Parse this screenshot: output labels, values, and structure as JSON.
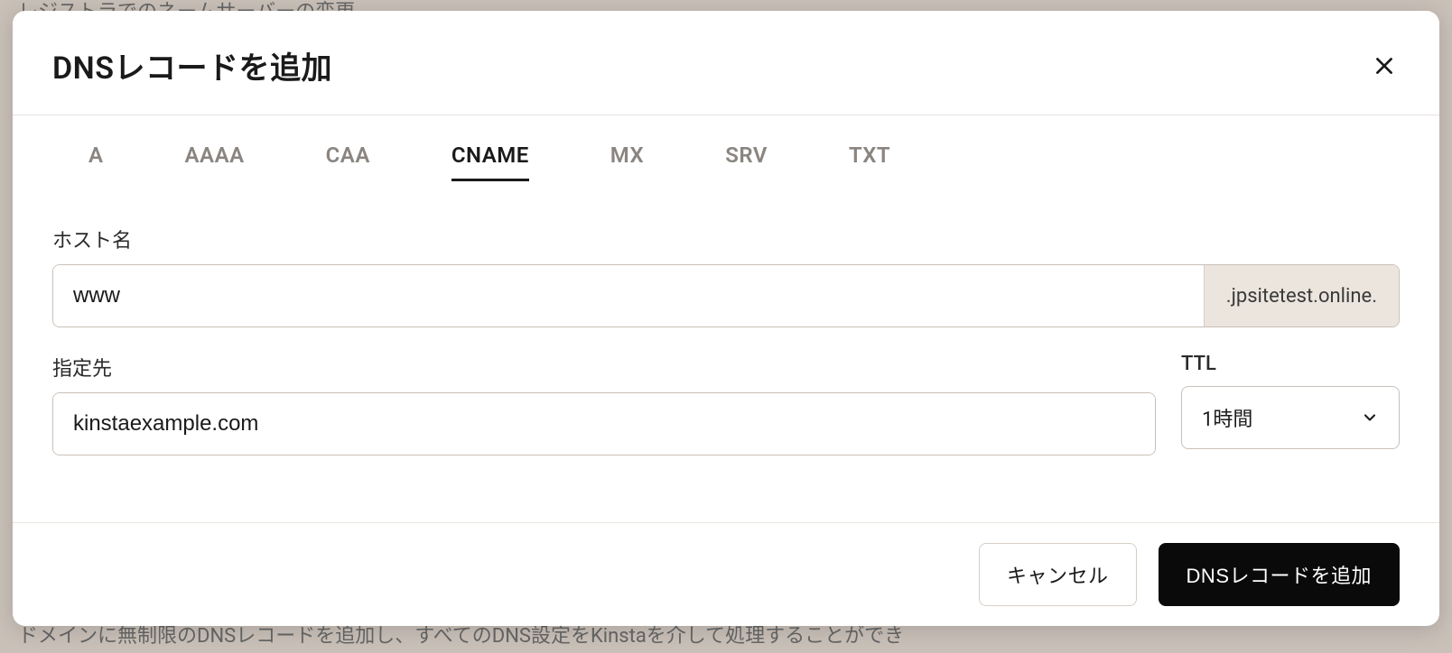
{
  "backdrop": {
    "top_text": "レジストラでのネームサーバーの変更",
    "bottom_text": "ドメインに無制限のDNSレコードを追加し、すべてのDNS設定をKinstaを介して処理することができ"
  },
  "modal": {
    "title": "DNSレコードを追加",
    "tabs": [
      "A",
      "AAAA",
      "CAA",
      "CNAME",
      "MX",
      "SRV",
      "TXT"
    ],
    "active_tab": "CNAME",
    "fields": {
      "hostname": {
        "label": "ホスト名",
        "value": "www",
        "suffix": ".jpsitetest.online."
      },
      "target": {
        "label": "指定先",
        "value": "kinstaexample.com"
      },
      "ttl": {
        "label": "TTL",
        "value": "1時間"
      }
    },
    "buttons": {
      "cancel": "キャンセル",
      "submit": "DNSレコードを追加"
    }
  }
}
